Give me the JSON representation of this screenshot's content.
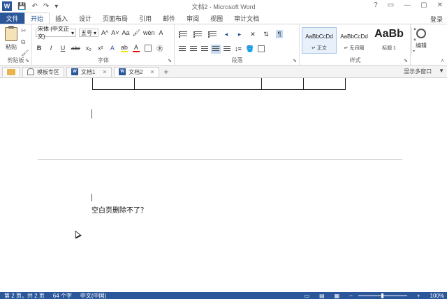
{
  "window": {
    "title": "文档2 - Microsoft Word",
    "app_icon": "W",
    "qat_icons": [
      "save-icon",
      "undo-icon",
      "redo-icon",
      "customize-icon"
    ],
    "controls": [
      "?",
      "▭",
      "—",
      "▢",
      "✕"
    ]
  },
  "ribbon_tabs": {
    "file": "文件",
    "tabs": [
      "开始",
      "插入",
      "设计",
      "页面布局",
      "引用",
      "邮件",
      "审阅",
      "视图",
      "审计文档"
    ],
    "active": "开始",
    "signin": "登录"
  },
  "ribbon": {
    "clipboard": {
      "paste": "粘贴",
      "label": "剪贴板"
    },
    "font": {
      "font_name": "宋体 (中文正文)",
      "font_size": "五号",
      "row1_icons": [
        "A^",
        "A˅",
        "Aa",
        "🖌",
        "wén",
        "A"
      ],
      "row2": [
        "B",
        "I",
        "U",
        "abc",
        "x₂",
        "x²"
      ],
      "label": "字体"
    },
    "paragraph": {
      "label": "段落"
    },
    "styles": {
      "items": [
        {
          "sample": "AaBbCcDd",
          "name": "↵ 正文"
        },
        {
          "sample": "AaBbCcDd",
          "name": "↵ 无间隔"
        },
        {
          "sample": "AaBb",
          "name": "标题 1"
        }
      ],
      "label": "样式"
    },
    "editing": {
      "label": "编辑"
    }
  },
  "doc_tabs": {
    "tabs": [
      {
        "label": "",
        "icon": "folder-icon"
      },
      {
        "label": "模板专区",
        "icon": "home-icon"
      },
      {
        "label": "文档1",
        "icon": "word-doc-icon"
      },
      {
        "label": "文档2",
        "icon": "word-doc-icon"
      }
    ],
    "right": [
      "显示多窗口",
      "▼"
    ]
  },
  "document": {
    "text_line": "空白页删除不了？"
  },
  "status": {
    "page": "第 2 页，共 2 页",
    "words": "64 个字",
    "language": "中文(中国)",
    "zoom": "100%",
    "zoom_minus": "−",
    "zoom_plus": "+"
  }
}
